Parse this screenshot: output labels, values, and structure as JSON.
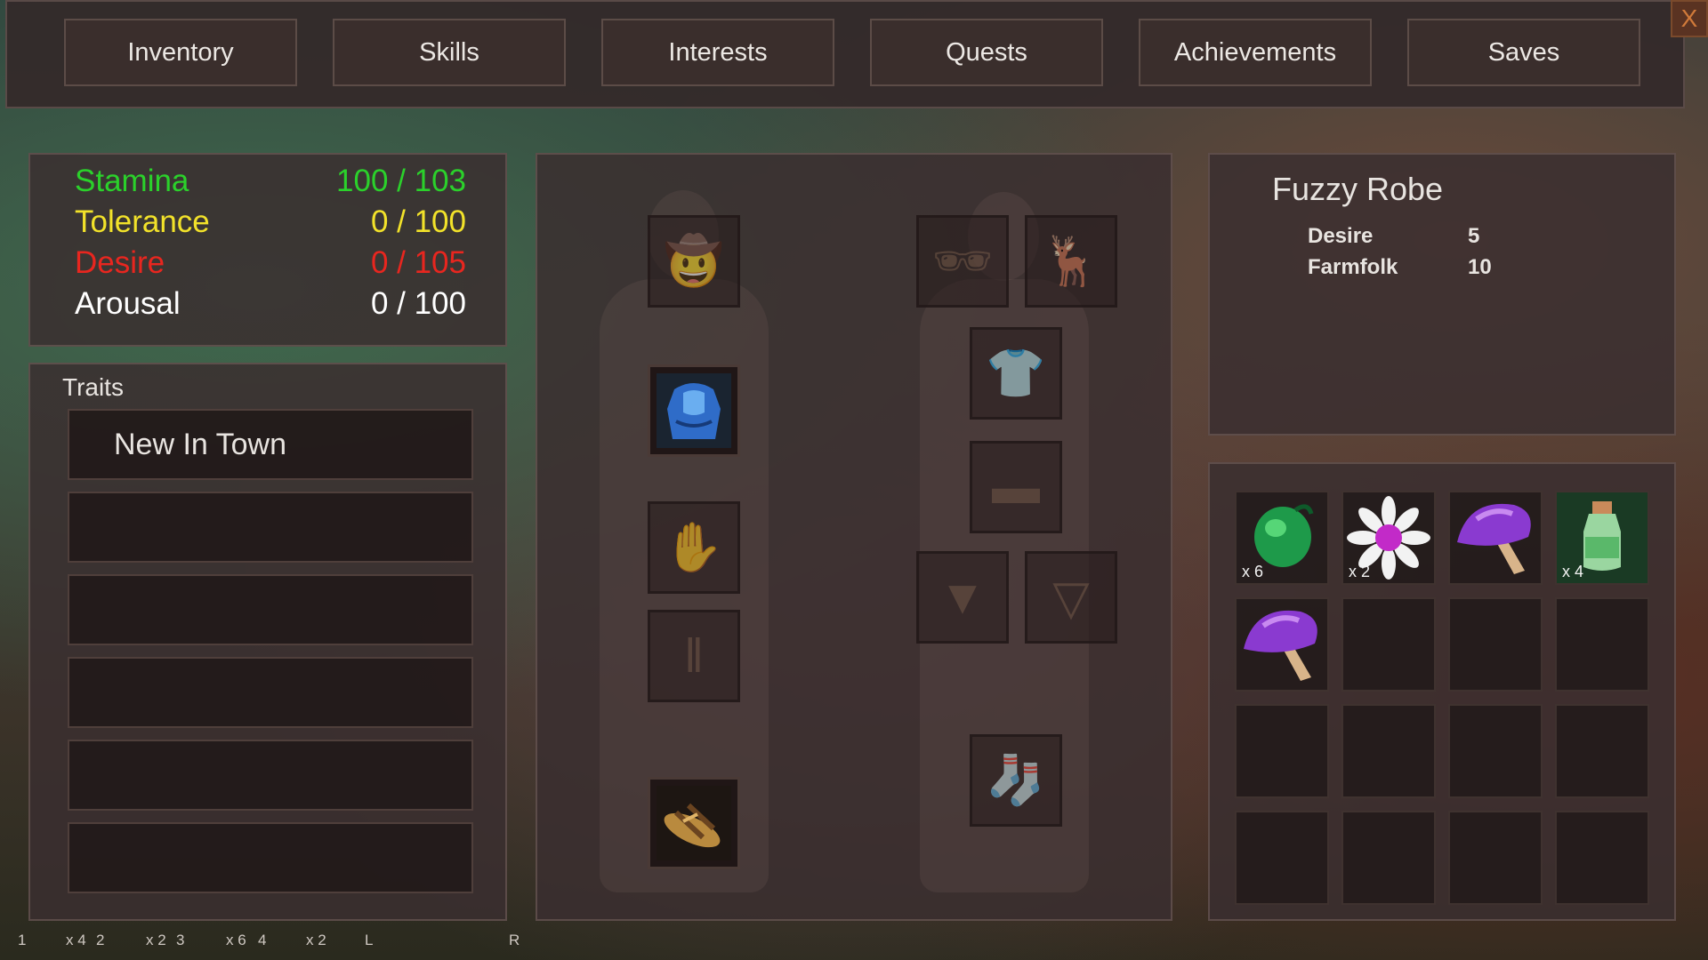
{
  "nav": {
    "tabs": [
      "Inventory",
      "Skills",
      "Interests",
      "Quests",
      "Achievements",
      "Saves"
    ],
    "close_label": "X"
  },
  "stats": [
    {
      "label": "Stamina",
      "value": "100 / 103",
      "color": "#2bd12b"
    },
    {
      "label": "Tolerance",
      "value": "0 / 100",
      "color": "#f2e22a"
    },
    {
      "label": "Desire",
      "value": "0 / 105",
      "color": "#e8261f"
    },
    {
      "label": "Arousal",
      "value": "0 / 100",
      "color": "#ffffff"
    }
  ],
  "traits": {
    "title": "Traits",
    "slots": [
      "New In Town",
      "",
      "",
      "",
      "",
      ""
    ]
  },
  "equipment": {
    "slots": [
      {
        "name": "head-slot",
        "icon": "hat-icon",
        "filled": false
      },
      {
        "name": "torso-slot",
        "icon": "blue-robe-icon",
        "filled": true
      },
      {
        "name": "hands-slot",
        "icon": "gloves-icon",
        "filled": false
      },
      {
        "name": "legs-slot",
        "icon": "pants-icon",
        "filled": false
      },
      {
        "name": "feet-slot",
        "icon": "sandals-icon",
        "filled": true
      },
      {
        "name": "eyes-slot",
        "icon": "glasses-icon",
        "filled": false
      },
      {
        "name": "horns-slot",
        "icon": "antlers-icon",
        "filled": false
      },
      {
        "name": "shirt-slot",
        "icon": "shirt-icon",
        "filled": false
      },
      {
        "name": "waist-slot",
        "icon": "belt-icon",
        "filled": false
      },
      {
        "name": "underwear-front-slot",
        "icon": "underwear-icon",
        "filled": false
      },
      {
        "name": "underwear-back-slot",
        "icon": "underwear-icon",
        "filled": false
      },
      {
        "name": "socks-slot",
        "icon": "socks-icon",
        "filled": false
      }
    ]
  },
  "item_info": {
    "name": "Fuzzy Robe",
    "stats": [
      {
        "key": "Desire",
        "value": "5"
      },
      {
        "key": "Farmfolk",
        "value": "10"
      }
    ]
  },
  "inventory": {
    "items": [
      {
        "icon": "green-seed-icon",
        "qty": "x 6"
      },
      {
        "icon": "daisy-flower-icon",
        "qty": "x 2"
      },
      {
        "icon": "purple-mushroom-icon",
        "qty": ""
      },
      {
        "icon": "potion-bottle-icon",
        "qty": "x 4"
      },
      {
        "icon": "purple-mushroom-icon",
        "qty": ""
      }
    ],
    "total_slots": 16
  },
  "hotbar": {
    "labels": [
      "1",
      "x 4",
      "2",
      "x 2",
      "3",
      "x 6",
      "4",
      "x 2",
      "L",
      "R"
    ]
  }
}
